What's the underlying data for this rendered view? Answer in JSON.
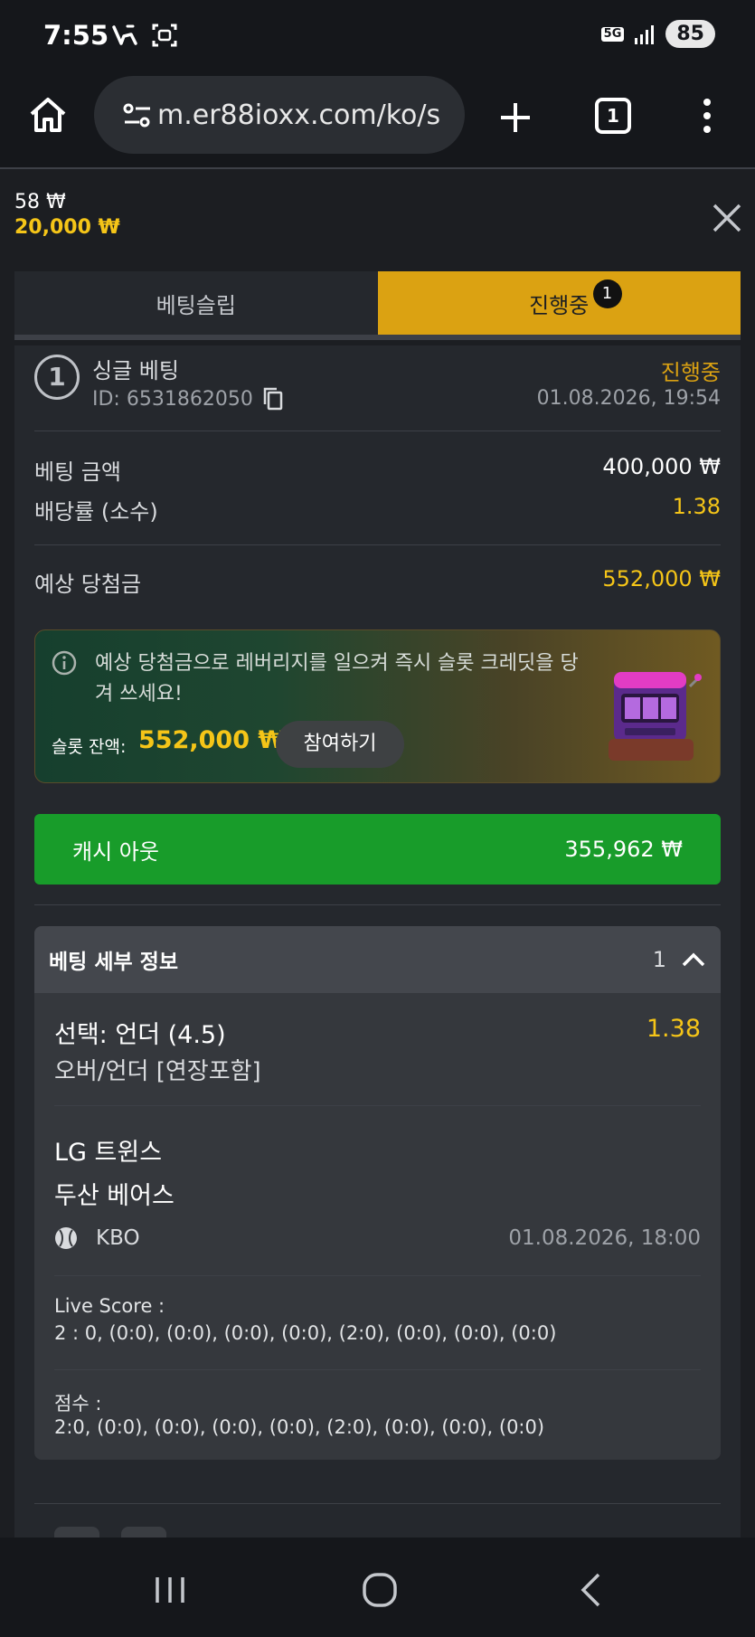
{
  "status_bar": {
    "time": "7:55",
    "network": "5G",
    "battery": "85"
  },
  "browser": {
    "url": "m.er88ioxx.com/ko/s",
    "tab_count": "1"
  },
  "balance": {
    "main": "58 ₩",
    "bonus": "20,000 ₩"
  },
  "tabs": {
    "betslip": "베팅슬립",
    "active": "진행중",
    "active_badge": "1"
  },
  "bet": {
    "number": "1",
    "type": "싱글 베팅",
    "id_label": "ID:",
    "id": "6531862050",
    "status": "진행중",
    "date": "01.08.2026, 19:54",
    "stake_label": "베팅 금액",
    "stake": "400,000 ₩",
    "odds_label": "배당률 (소수)",
    "odds": "1.38",
    "potential_label": "예상 당첨금",
    "potential": "552,000 ₩"
  },
  "promo": {
    "text": "예상 당첨금으로 레버리지를 일으켜 즉시 슬롯 크레딧을 당겨 쓰세요!",
    "slot_label": "슬롯 잔액:",
    "slot_value": "552,000 ₩",
    "button": "참여하기"
  },
  "cashout": {
    "label": "캐시 아웃",
    "value": "355,962 ₩"
  },
  "details": {
    "title": "베팅 세부 정보",
    "count": "1",
    "selection": "선택: 언더 (4.5)",
    "selection_odds": "1.38",
    "market": "오버/언더 [연장포함]",
    "team1": "LG 트윈스",
    "team2": "두산 베어스",
    "league": "KBO",
    "match_date": "01.08.2026, 18:00",
    "live_score_label": "Live Score :",
    "live_score": "2 : 0, (0:0), (0:0), (0:0), (0:0), (2:0), (0:0), (0:0), (0:0)",
    "score_label": "점수 :",
    "score": "2:0, (0:0), (0:0), (0:0), (0:0), (2:0), (0:0), (0:0), (0:0)"
  },
  "icons": {
    "home": "home-icon",
    "site_settings": "tune-icon",
    "add_tab": "plus-icon",
    "menu": "kebab-menu-icon",
    "close": "close-icon",
    "copy": "copy-icon",
    "info": "info-icon",
    "collapse": "chevron-up-icon",
    "sport": "baseball-icon"
  },
  "colors": {
    "accent": "#dba212",
    "odds": "#f5c518",
    "cashout": "#189c2a",
    "background": "#1c1e22"
  }
}
